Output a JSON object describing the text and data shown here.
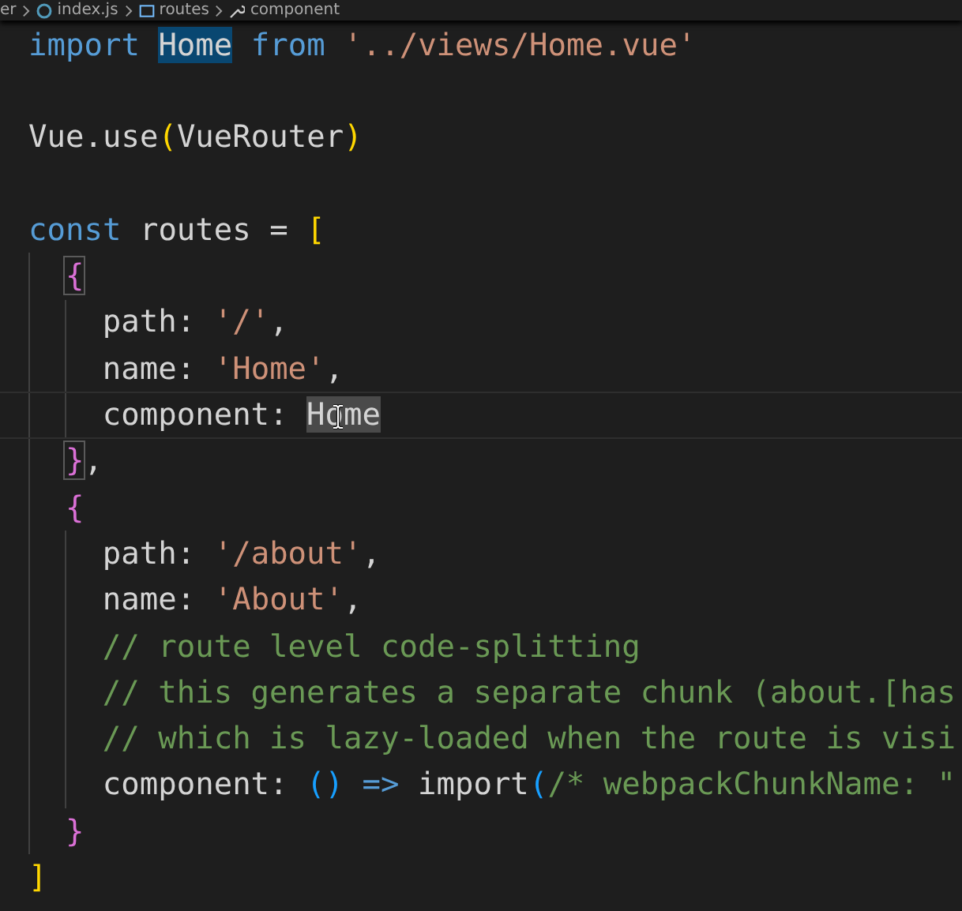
{
  "breadcrumb": [
    {
      "label": "er",
      "kind": "folder"
    },
    {
      "label": "index.js",
      "kind": "file"
    },
    {
      "label": "routes",
      "kind": "variable"
    },
    {
      "label": "component",
      "kind": "property"
    }
  ],
  "lines": [
    {
      "kind": "code",
      "current": false,
      "tokens": [
        {
          "text": "import ",
          "kind": "keyword"
        },
        {
          "text": "Home",
          "kind": "ident",
          "occurrence": true
        },
        {
          "text": " from ",
          "kind": "keyword"
        },
        {
          "text": "'../views/Home.vue'",
          "kind": "string"
        }
      ]
    },
    {
      "kind": "blank",
      "current": false
    },
    {
      "kind": "code",
      "current": false,
      "tokens": [
        {
          "text": "Vue.use",
          "kind": "ident"
        },
        {
          "text": "(",
          "kind": "bracket1"
        },
        {
          "text": "VueRouter",
          "kind": "ident"
        },
        {
          "text": ")",
          "kind": "bracket1"
        }
      ]
    },
    {
      "kind": "blank",
      "current": false
    },
    {
      "kind": "code",
      "current": false,
      "tokens": [
        {
          "text": "const ",
          "kind": "keyword"
        },
        {
          "text": "routes = ",
          "kind": "ident"
        },
        {
          "text": "[",
          "kind": "bracket1"
        }
      ],
      "children": [
        {
          "kind": "code",
          "current": false,
          "tokens": [
            {
              "text": "{",
              "kind": "bracket2",
              "bracket_match": true
            }
          ],
          "children": [
            {
              "kind": "code",
              "current": false,
              "tokens": [
                {
                  "text": "path: ",
                  "kind": "ident"
                },
                {
                  "text": "'/'",
                  "kind": "string"
                },
                {
                  "text": ",",
                  "kind": "ident"
                }
              ]
            },
            {
              "kind": "code",
              "current": false,
              "tokens": [
                {
                  "text": "name: ",
                  "kind": "ident"
                },
                {
                  "text": "'Home'",
                  "kind": "string"
                },
                {
                  "text": ",",
                  "kind": "ident"
                }
              ]
            },
            {
              "kind": "code",
              "current": true,
              "tokens": [
                {
                  "text": "component: ",
                  "kind": "ident"
                },
                {
                  "text": "Home",
                  "kind": "ident",
                  "selected": true
                }
              ]
            }
          ]
        },
        {
          "kind": "code",
          "current": false,
          "tokens": [
            {
              "text": "}",
              "kind": "bracket2",
              "bracket_match": true
            },
            {
              "text": ",",
              "kind": "ident"
            }
          ]
        },
        {
          "kind": "code",
          "current": false,
          "tokens": [
            {
              "text": "{",
              "kind": "bracket2"
            }
          ],
          "children": [
            {
              "kind": "code",
              "current": false,
              "tokens": [
                {
                  "text": "path: ",
                  "kind": "ident"
                },
                {
                  "text": "'/about'",
                  "kind": "string"
                },
                {
                  "text": ",",
                  "kind": "ident"
                }
              ]
            },
            {
              "kind": "code",
              "current": false,
              "tokens": [
                {
                  "text": "name: ",
                  "kind": "ident"
                },
                {
                  "text": "'About'",
                  "kind": "string"
                },
                {
                  "text": ",",
                  "kind": "ident"
                }
              ]
            },
            {
              "kind": "code",
              "current": false,
              "tokens": [
                {
                  "text": "// route level code-splitting",
                  "kind": "comment"
                }
              ]
            },
            {
              "kind": "code",
              "current": false,
              "tokens": [
                {
                  "text": "// this generates a separate chunk (about.[has",
                  "kind": "comment"
                }
              ]
            },
            {
              "kind": "code",
              "current": false,
              "tokens": [
                {
                  "text": "// which is lazy-loaded when the route is visi",
                  "kind": "comment"
                }
              ]
            },
            {
              "kind": "code",
              "current": false,
              "tokens": [
                {
                  "text": "component: ",
                  "kind": "ident"
                },
                {
                  "text": "()",
                  "kind": "bracket3"
                },
                {
                  "text": " => ",
                  "kind": "keyword"
                },
                {
                  "text": "import",
                  "kind": "ident"
                },
                {
                  "text": "(",
                  "kind": "bracket3"
                },
                {
                  "text": "/* webpackChunkName: \"",
                  "kind": "comment"
                }
              ]
            }
          ]
        },
        {
          "kind": "code",
          "current": false,
          "tokens": [
            {
              "text": "}",
              "kind": "bracket2"
            }
          ]
        }
      ]
    },
    {
      "kind": "code",
      "current": false,
      "tokens": [
        {
          "text": "]",
          "kind": "bracket1"
        }
      ]
    }
  ]
}
